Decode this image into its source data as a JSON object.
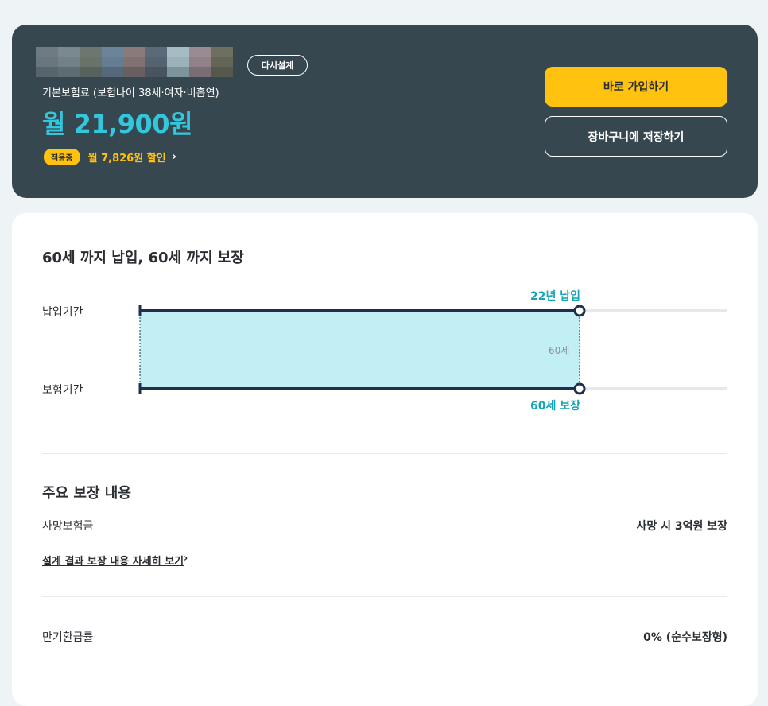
{
  "header": {
    "redesign_label": "다시설계",
    "base_premium_label": "기본보험료 (보험나이 38세·여자·비흡연)",
    "monthly_premium": "월 21,900원",
    "discount_badge": "적용중",
    "discount_text": "월 7,826원 할인",
    "discount_chevron": "›",
    "join_button": "바로 가입하기",
    "cart_button": "장바구니에 저장하기"
  },
  "period": {
    "title": "60세 까지 납입, 60세 까지 보장",
    "payment_label": "납입기간",
    "coverage_label": "보험기간",
    "payment_marker": "22년 납입",
    "coverage_marker": "60세 보장",
    "age_label": "60세",
    "payment_years": 22,
    "coverage_end_age": 60
  },
  "coverage": {
    "title": "주요 보장 내용",
    "items": [
      {
        "label": "사망보험금",
        "value": "사망 시 3억원 보장"
      }
    ],
    "detail_link": "설계 결과 보장 내용 자세히 보기",
    "detail_chevron": "›"
  },
  "maturity": {
    "label": "만기환급률",
    "value": "0% (순수보장형)"
  },
  "colors": {
    "header_bg": "#37474f",
    "accent_teal": "#33c7dd",
    "accent_yellow": "#ffc20e",
    "chart_fill": "#c1eff4",
    "bar_navy": "#1f2f4d"
  }
}
